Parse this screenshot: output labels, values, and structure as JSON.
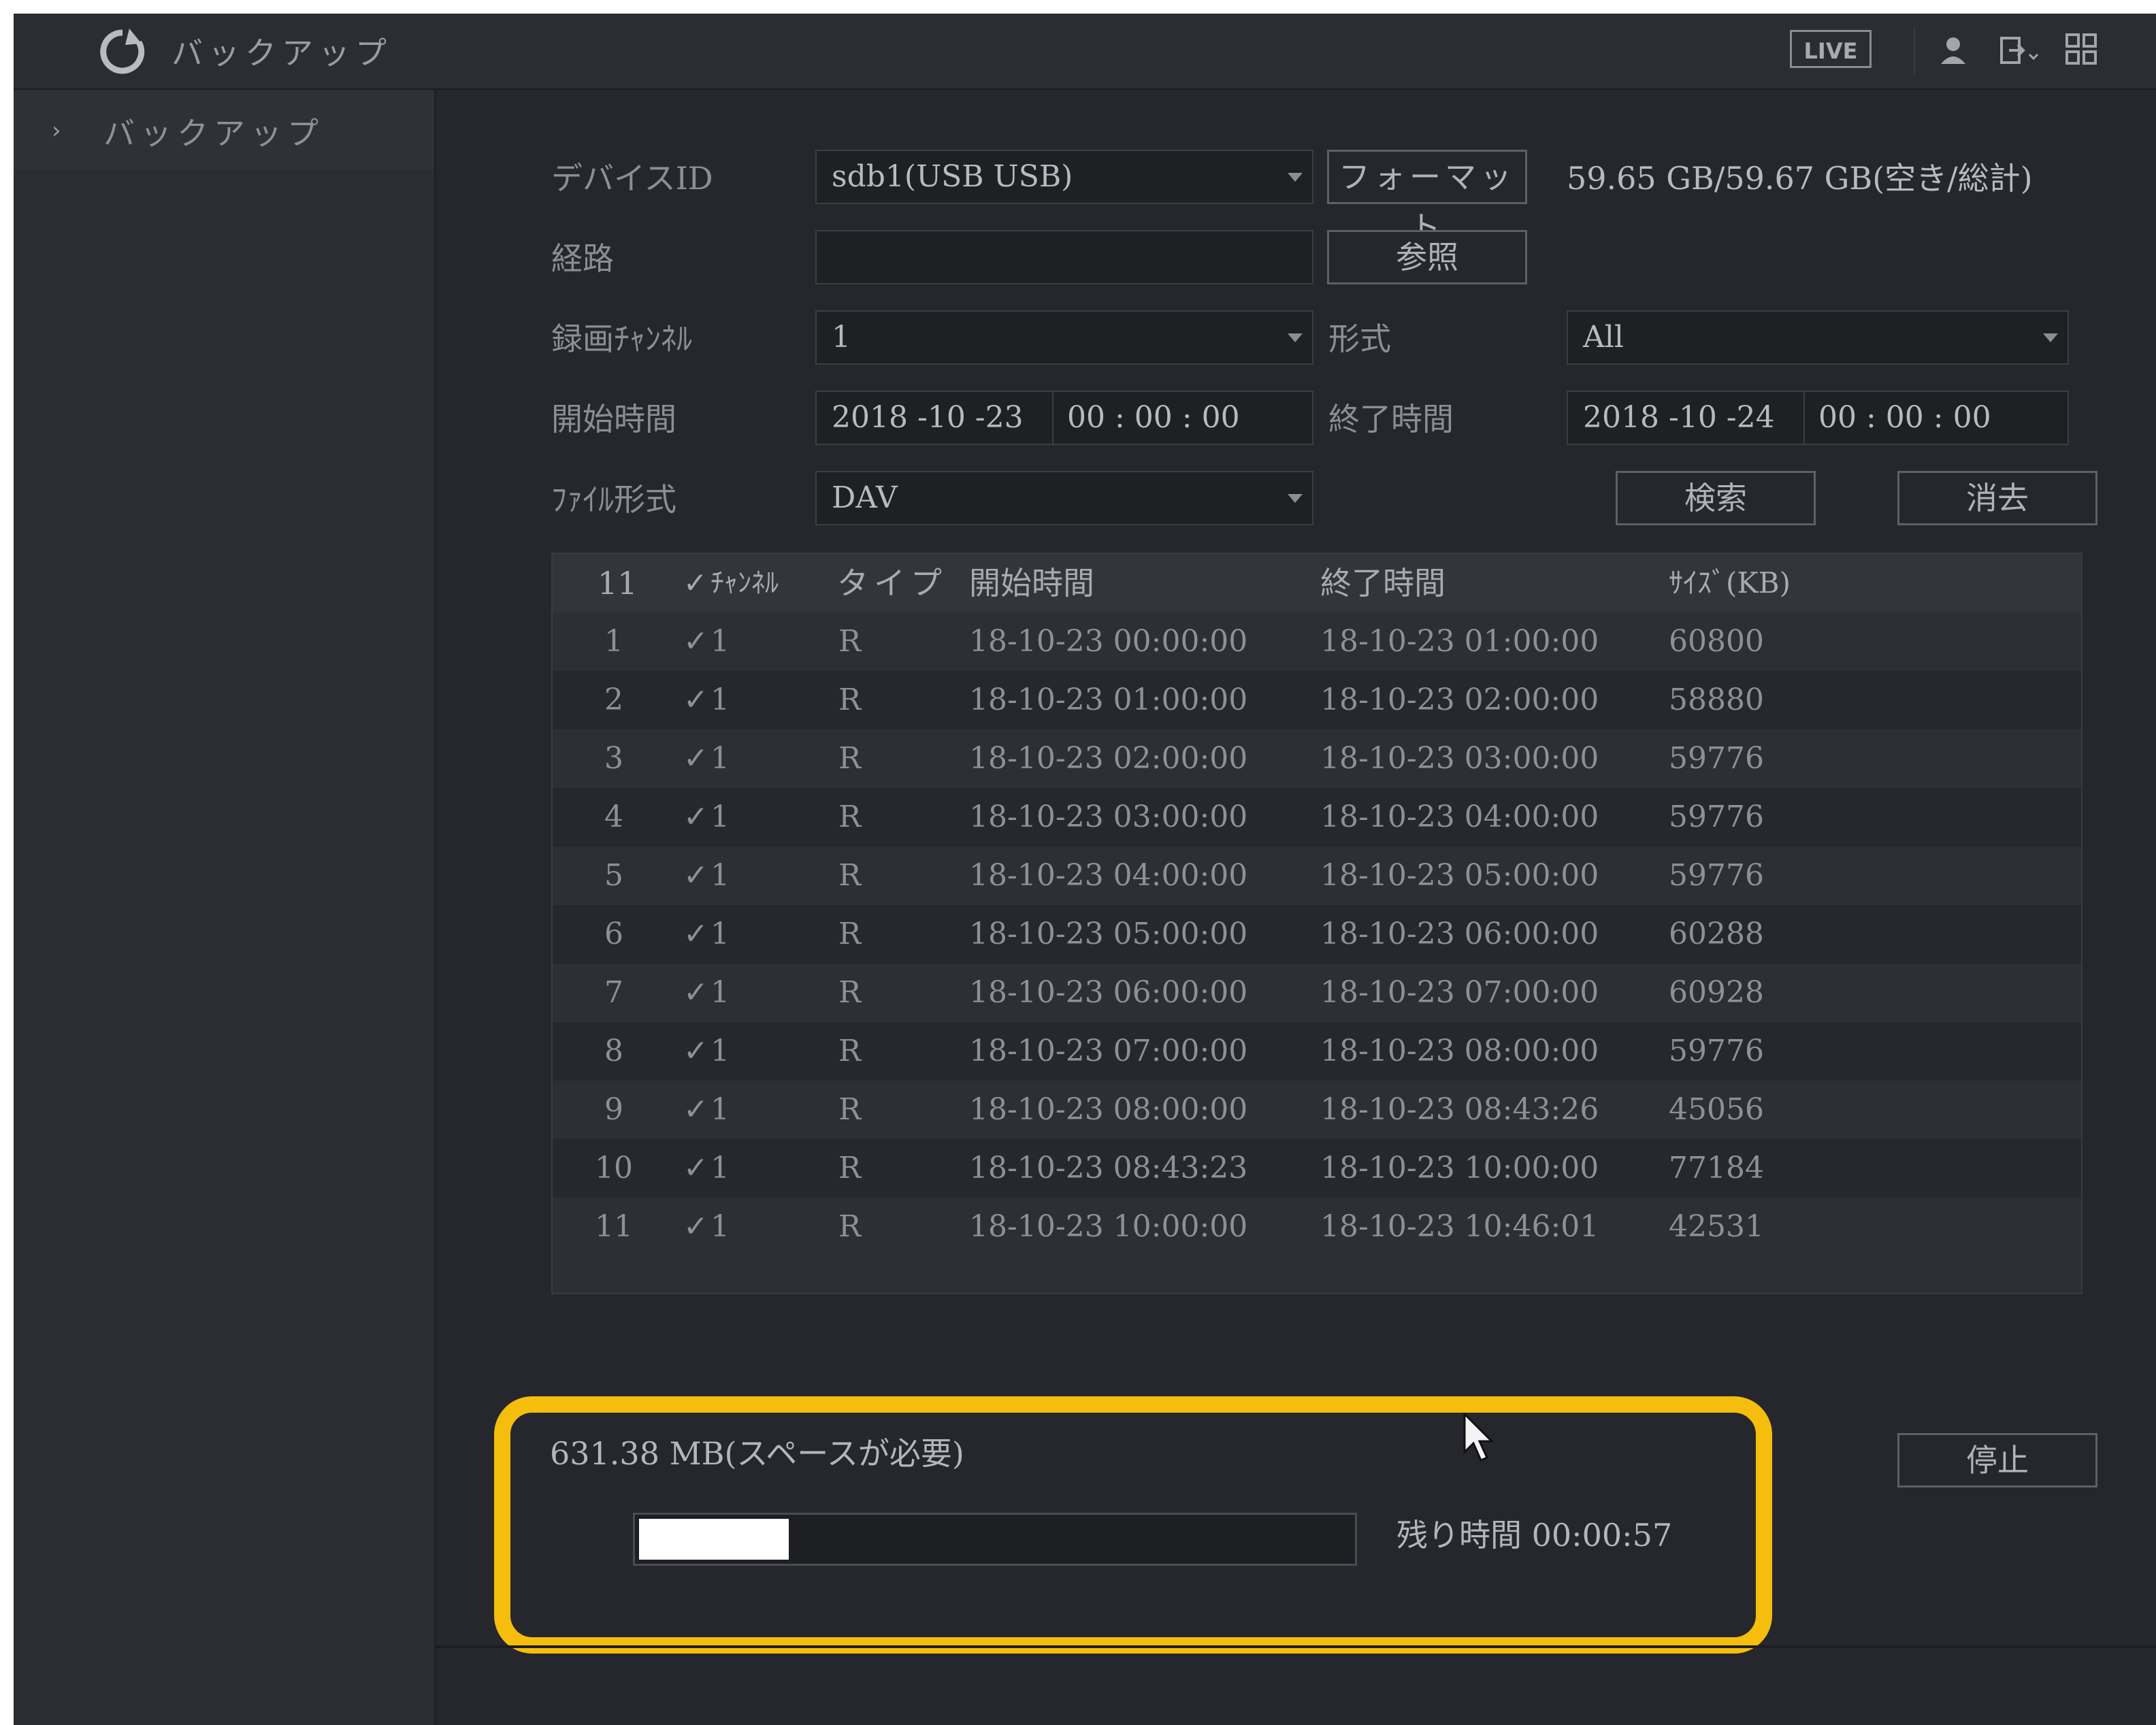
{
  "app": {
    "title": "バックアップ"
  },
  "topbar": {
    "live_label": "LIVE"
  },
  "sidebar": {
    "items": [
      {
        "label": "バックアップ"
      }
    ]
  },
  "form": {
    "device_id_label": "デバイスID",
    "device_id_value": "sdb1(USB USB)",
    "format_button": "フォーマット",
    "capacity_text": "59.65 GB/59.67 GB(空き/総計)",
    "path_label": "経路",
    "path_value": "",
    "browse_button": "参照",
    "channel_label": "録画ﾁｬﾝﾈﾙ",
    "channel_value": "1",
    "type_label": "形式",
    "type_value": "All",
    "start_label": "開始時間",
    "start_date": "2018 -10 -23",
    "start_time": "00 : 00 : 00",
    "end_label": "終了時間",
    "end_date": "2018 -10 -24",
    "end_time": "00 : 00 : 00",
    "file_format_label": "ﾌｧｲﾙ形式",
    "file_format_value": "DAV",
    "search_button": "検索",
    "clear_button": "消去"
  },
  "table": {
    "headers": {
      "count": "11",
      "channel": "ﾁｬﾝﾈﾙ",
      "type": "タイプ",
      "start": "開始時間",
      "end": "終了時間",
      "size": "ｻｲｽﾞ(KB)"
    },
    "rows": [
      {
        "no": "1",
        "channel": "1",
        "type": "R",
        "start": "18-10-23 00:00:00",
        "end": "18-10-23 01:00:00",
        "size": "60800"
      },
      {
        "no": "2",
        "channel": "1",
        "type": "R",
        "start": "18-10-23 01:00:00",
        "end": "18-10-23 02:00:00",
        "size": "58880"
      },
      {
        "no": "3",
        "channel": "1",
        "type": "R",
        "start": "18-10-23 02:00:00",
        "end": "18-10-23 03:00:00",
        "size": "59776"
      },
      {
        "no": "4",
        "channel": "1",
        "type": "R",
        "start": "18-10-23 03:00:00",
        "end": "18-10-23 04:00:00",
        "size": "59776"
      },
      {
        "no": "5",
        "channel": "1",
        "type": "R",
        "start": "18-10-23 04:00:00",
        "end": "18-10-23 05:00:00",
        "size": "59776"
      },
      {
        "no": "6",
        "channel": "1",
        "type": "R",
        "start": "18-10-23 05:00:00",
        "end": "18-10-23 06:00:00",
        "size": "60288"
      },
      {
        "no": "7",
        "channel": "1",
        "type": "R",
        "start": "18-10-23 06:00:00",
        "end": "18-10-23 07:00:00",
        "size": "60928"
      },
      {
        "no": "8",
        "channel": "1",
        "type": "R",
        "start": "18-10-23 07:00:00",
        "end": "18-10-23 08:00:00",
        "size": "59776"
      },
      {
        "no": "9",
        "channel": "1",
        "type": "R",
        "start": "18-10-23 08:00:00",
        "end": "18-10-23 08:43:26",
        "size": "45056"
      },
      {
        "no": "10",
        "channel": "1",
        "type": "R",
        "start": "18-10-23 08:43:23",
        "end": "18-10-23 10:00:00",
        "size": "77184"
      },
      {
        "no": "11",
        "channel": "1",
        "type": "R",
        "start": "18-10-23 10:00:00",
        "end": "18-10-23 10:46:01",
        "size": "42531"
      }
    ]
  },
  "backup": {
    "space_needed": "631.38 MB(スペースが必要)",
    "progress_percent": 21,
    "remaining": "残り時間 00:00:57",
    "stop_button": "停止"
  },
  "colors": {
    "highlight": "#f5bd0c",
    "background": "#26272c",
    "progress_fill": "#ffffff"
  },
  "icons": [
    "refresh-icon",
    "user-icon",
    "logout-icon",
    "grid-icon",
    "chevron-right-icon",
    "dropdown-caret-icon",
    "checkbox-checked-icon",
    "mouse-cursor-icon"
  ]
}
